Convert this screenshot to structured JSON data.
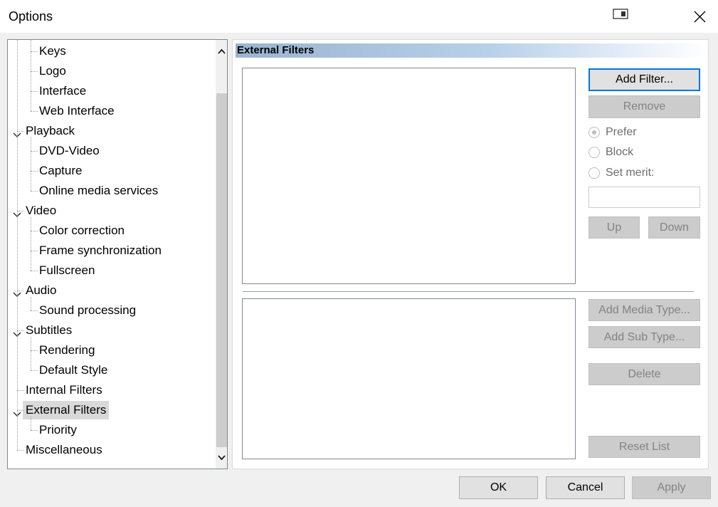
{
  "window": {
    "title": "Options",
    "close_icon": "close-icon",
    "snap_icon": "snap-layout-icon"
  },
  "tree": {
    "items": [
      {
        "label": "Keys",
        "level": 2
      },
      {
        "label": "Logo",
        "level": 2
      },
      {
        "label": "Interface",
        "level": 2
      },
      {
        "label": "Web Interface",
        "level": 2
      },
      {
        "label": "Playback",
        "level": 1,
        "expanded": true
      },
      {
        "label": "DVD-Video",
        "level": 2
      },
      {
        "label": "Capture",
        "level": 2
      },
      {
        "label": "Online media services",
        "level": 2
      },
      {
        "label": "Video",
        "level": 1,
        "expanded": true
      },
      {
        "label": "Color correction",
        "level": 2
      },
      {
        "label": "Frame synchronization",
        "level": 2
      },
      {
        "label": "Fullscreen",
        "level": 2
      },
      {
        "label": "Audio",
        "level": 1,
        "expanded": true
      },
      {
        "label": "Sound processing",
        "level": 2
      },
      {
        "label": "Subtitles",
        "level": 1,
        "expanded": true
      },
      {
        "label": "Rendering",
        "level": 2
      },
      {
        "label": "Default Style",
        "level": 2
      },
      {
        "label": "Internal Filters",
        "level": 1
      },
      {
        "label": "External Filters",
        "level": 1,
        "expanded": true,
        "selected": true
      },
      {
        "label": "Priority",
        "level": 2
      },
      {
        "label": "Miscellaneous",
        "level": 1
      }
    ]
  },
  "page": {
    "header": "External Filters",
    "buttons": {
      "add_filter": "Add Filter...",
      "remove": "Remove",
      "up": "Up",
      "down": "Down",
      "add_media_type": "Add Media Type...",
      "add_sub_type": "Add Sub Type...",
      "delete": "Delete",
      "reset_list": "Reset List"
    },
    "radios": {
      "prefer": "Prefer",
      "block": "Block",
      "set_merit": "Set merit:"
    },
    "selected_radio": "prefer",
    "merit_value": ""
  },
  "footer": {
    "ok": "OK",
    "cancel": "Cancel",
    "apply": "Apply"
  },
  "colors": {
    "header_gradient_start": "#99b4d1",
    "default_button_border": "#0078d7",
    "selected_item_bg": "#d9d9d9"
  }
}
